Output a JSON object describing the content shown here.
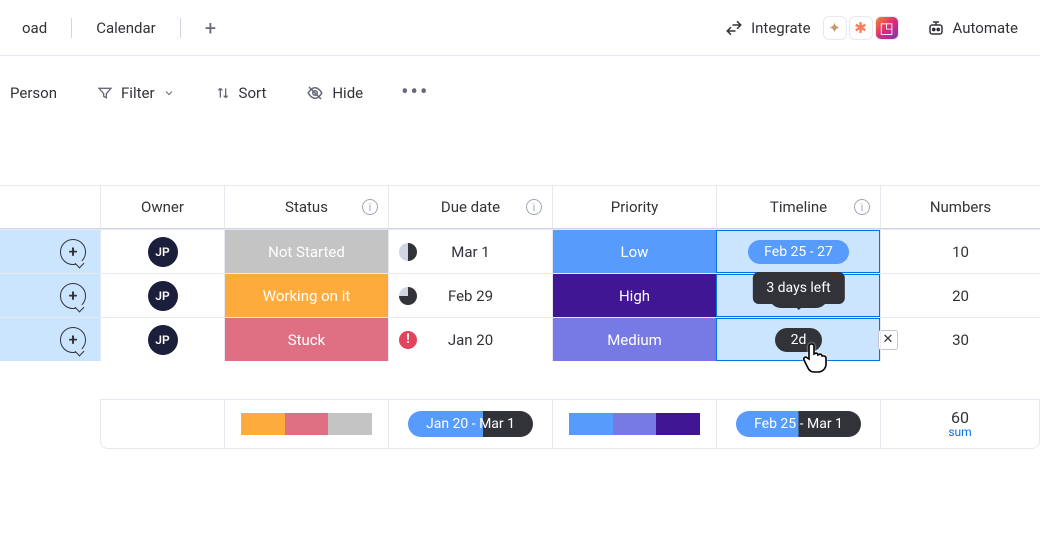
{
  "topbar": {
    "tab1": "oad",
    "tab2": "Calendar",
    "integrate": "Integrate",
    "automate": "Automate"
  },
  "toolbar": {
    "person": "Person",
    "filter": "Filter",
    "sort": "Sort",
    "hide": "Hide"
  },
  "columns": {
    "owner": "Owner",
    "status": "Status",
    "due": "Due date",
    "priority": "Priority",
    "timeline": "Timeline",
    "numbers": "Numbers"
  },
  "rows": [
    {
      "owner": "JP",
      "status_label": "Not Started",
      "status_color": "#c4c4c4",
      "due": "Mar 1",
      "due_icon": "half",
      "priority_label": "Low",
      "priority_color": "#579bfc",
      "timeline_label": "Feb 25 - 27",
      "timeline_bg": "#579bfc",
      "number": "10"
    },
    {
      "owner": "JP",
      "status_label": "Working on it",
      "status_color": "#fdab3d",
      "due": "Feb 29",
      "due_icon": "three",
      "priority_label": "High",
      "priority_color": "#401694",
      "timeline_label": "",
      "timeline_bg": "#323338",
      "number": "20",
      "tooltip": "3 days left"
    },
    {
      "owner": "JP",
      "status_label": "Stuck",
      "status_color": "#df7084",
      "due": "Jan 20",
      "due_icon": "alert",
      "priority_label": "Medium",
      "priority_color": "#777ae5",
      "timeline_label": "2d",
      "timeline_bg": "#323338",
      "number": "30",
      "cursor": true,
      "clear": true
    }
  ],
  "summary": {
    "status_colors": [
      "#fdab3d",
      "#df7084",
      "#c4c4c4"
    ],
    "due_pill": "Jan 20 - Mar 1",
    "priority_colors": [
      "#579bfc",
      "#777ae5",
      "#401694"
    ],
    "timeline_pill": "Feb 25 - Mar 1",
    "number_total": "60",
    "number_label": "sum"
  }
}
